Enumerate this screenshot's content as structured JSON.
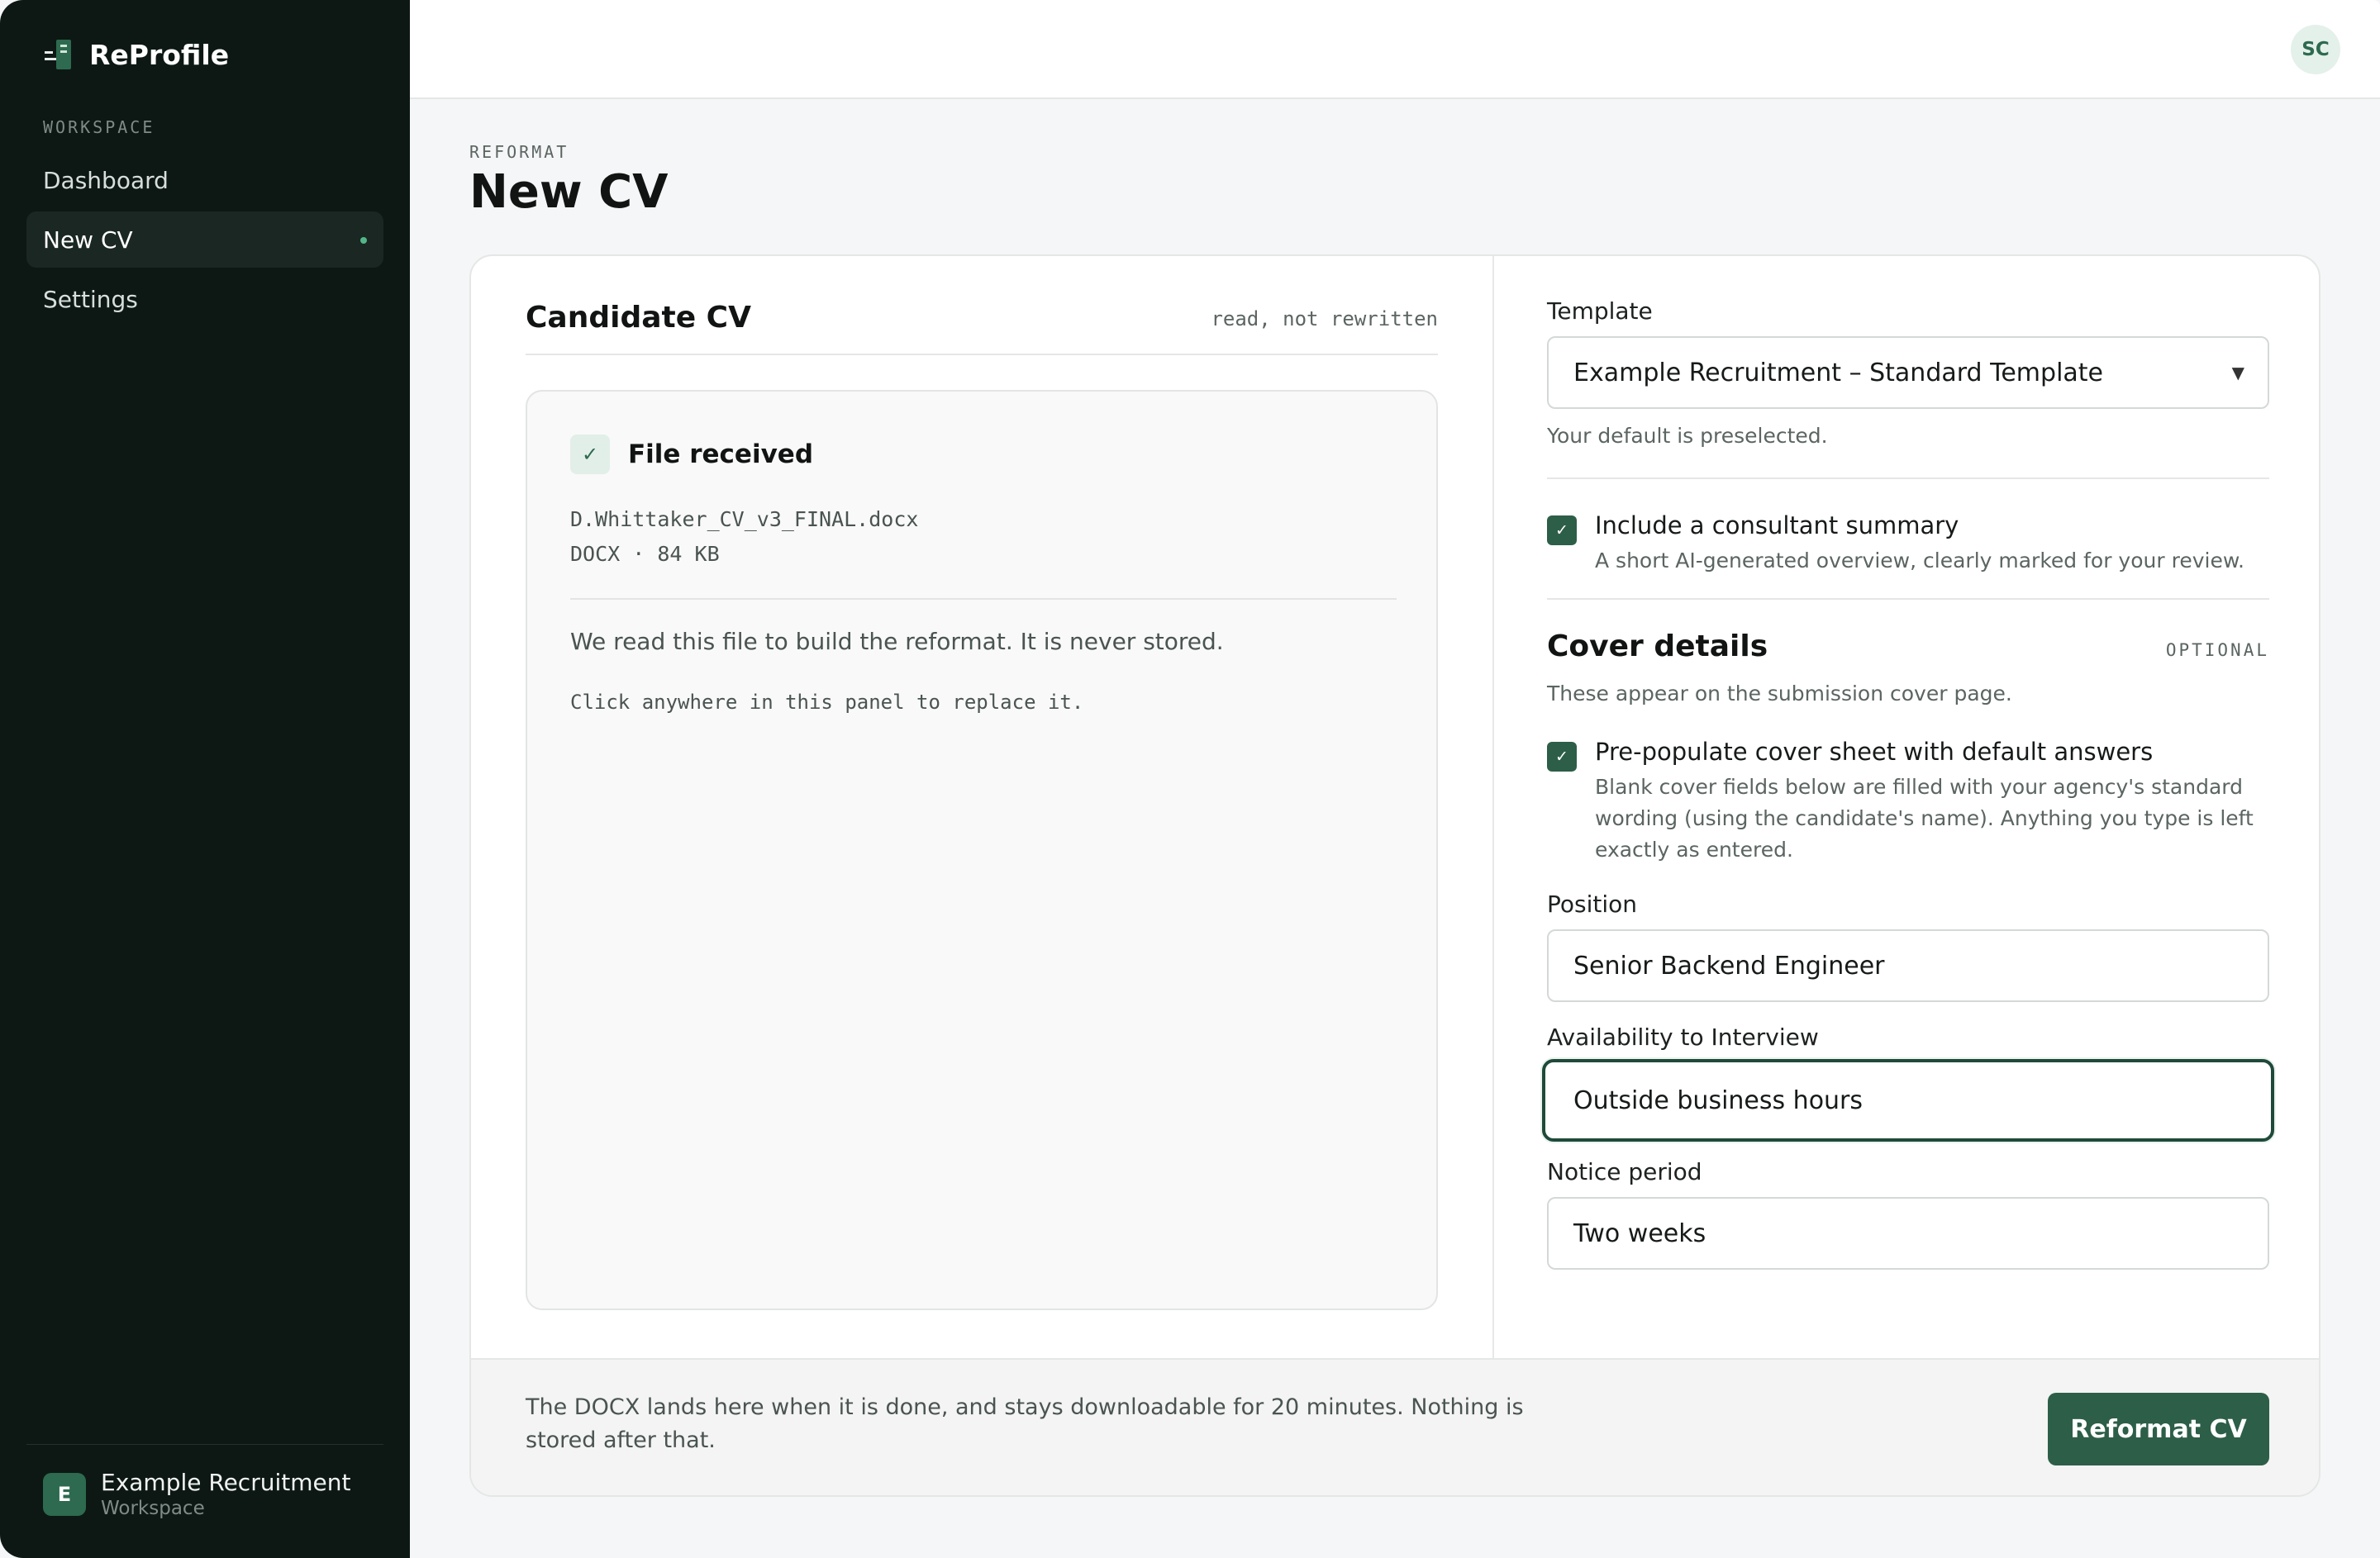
{
  "app": {
    "name": "ReProfile"
  },
  "sidebar": {
    "section_label": "WORKSPACE",
    "items": [
      {
        "label": "Dashboard",
        "active": false
      },
      {
        "label": "New CV",
        "active": true
      },
      {
        "label": "Settings",
        "active": false
      }
    ],
    "workspace": {
      "initial": "E",
      "name": "Example Recruitment",
      "subtitle": "Workspace"
    }
  },
  "topbar": {
    "user_initials": "SC"
  },
  "page": {
    "eyebrow": "REFORMAT",
    "title": "New CV"
  },
  "candidate": {
    "title": "Candidate CV",
    "note": "read, not rewritten",
    "status_label": "File received",
    "file_name": "D.Whittaker_CV_v3_FINAL.docx",
    "file_meta": "DOCX · 84 KB",
    "description": "We read this file to build the reformat. It is never stored.",
    "hint": "Click anywhere in this panel to replace it."
  },
  "options": {
    "template_label": "Template",
    "template_value": "Example Recruitment – Standard Template",
    "template_help": "Your default is preselected.",
    "summary": {
      "checked": true,
      "title": "Include a consultant summary",
      "desc": "A short AI-generated overview, clearly marked for your review."
    },
    "cover": {
      "title": "Cover details",
      "badge": "OPTIONAL",
      "help": "These appear on the submission cover page.",
      "prepopulate": {
        "checked": true,
        "title": "Pre-populate cover sheet with default answers",
        "desc": "Blank cover fields below are filled with your agency's standard wording (using the candidate's name). Anything you type is left exactly as entered."
      },
      "fields": [
        {
          "label": "Position",
          "value": "Senior Backend Engineer"
        },
        {
          "label": "Availability to Interview",
          "value": "Outside business hours"
        },
        {
          "label": "Notice period",
          "value": "Two weeks"
        }
      ]
    }
  },
  "footer": {
    "text": "The DOCX lands here when it is done, and stays downloadable for 20 minutes. Nothing is stored after that.",
    "button_label": "Reformat CV"
  },
  "colors": {
    "accent": "#2d5e48",
    "sidebar_bg": "#0d1815",
    "active_dot": "#52b788"
  }
}
